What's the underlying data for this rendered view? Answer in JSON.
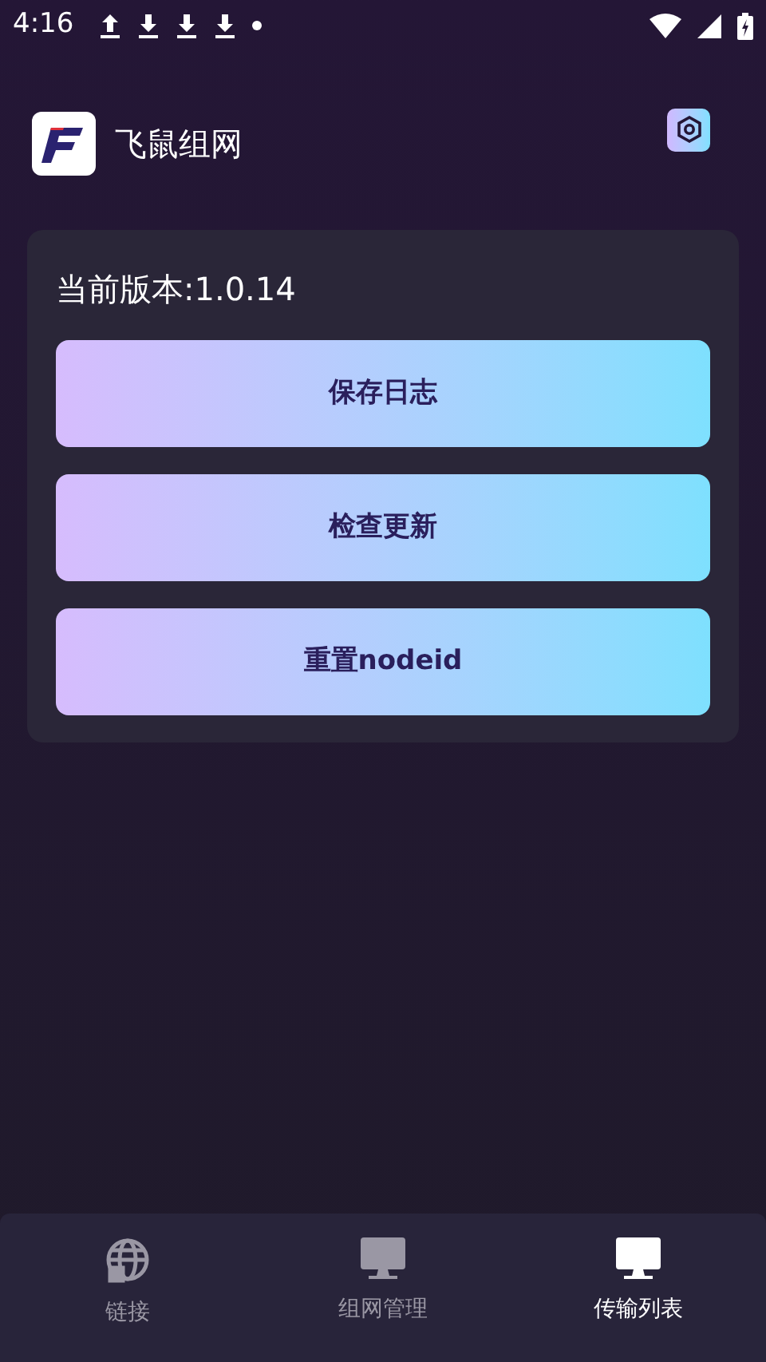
{
  "status_bar": {
    "time": "4:16"
  },
  "app_bar": {
    "title": "飞鼠组网"
  },
  "card": {
    "version": "当前版本:1.0.14",
    "buttons": [
      "保存日志",
      "检查更新",
      "重置nodeid"
    ]
  },
  "bottom_nav": [
    {
      "label": "链接",
      "kind": "globe",
      "selected": false
    },
    {
      "label": "组网管理",
      "kind": "monitor",
      "selected": false
    },
    {
      "label": "传输列表",
      "kind": "monitor",
      "selected": true
    }
  ]
}
